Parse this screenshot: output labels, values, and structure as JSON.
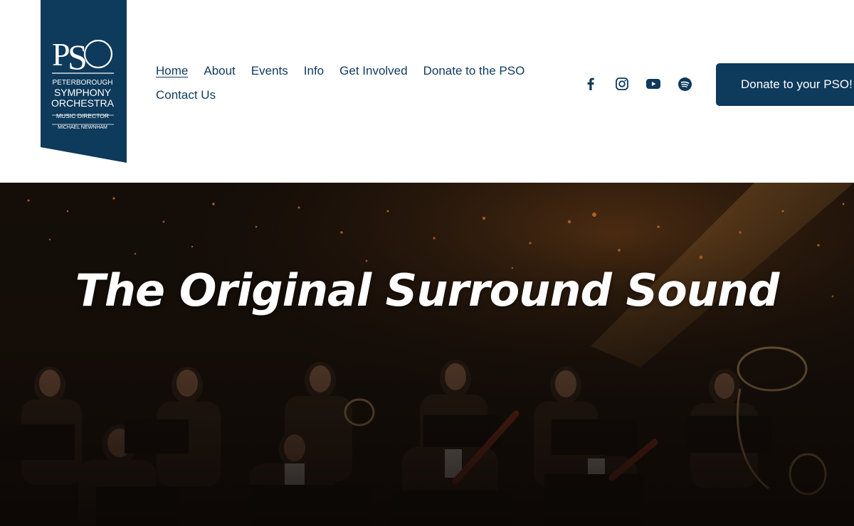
{
  "logo": {
    "monogram": "PSO",
    "line1": "PETERBOROUGH",
    "line2": "SYMPHONY",
    "line3": "ORCHESTRA",
    "line4": "MUSIC DIRECTOR",
    "line5": "MICHAEL NEWNHAM"
  },
  "nav": {
    "items": [
      {
        "label": "Home",
        "active": true
      },
      {
        "label": "About"
      },
      {
        "label": "Events"
      },
      {
        "label": "Info"
      },
      {
        "label": "Get Involved"
      },
      {
        "label": "Donate to the PSO"
      },
      {
        "label": "Contact Us"
      }
    ]
  },
  "social": [
    "facebook-icon",
    "instagram-icon",
    "youtube-icon",
    "spotify-icon"
  ],
  "header": {
    "donate_label": "Donate to your PSO!"
  },
  "hero": {
    "title": "The Original Surround Sound"
  },
  "colors": {
    "brand": "#0e3a5b",
    "text": "#0f3a5c",
    "hero_bg": "#120b06"
  }
}
